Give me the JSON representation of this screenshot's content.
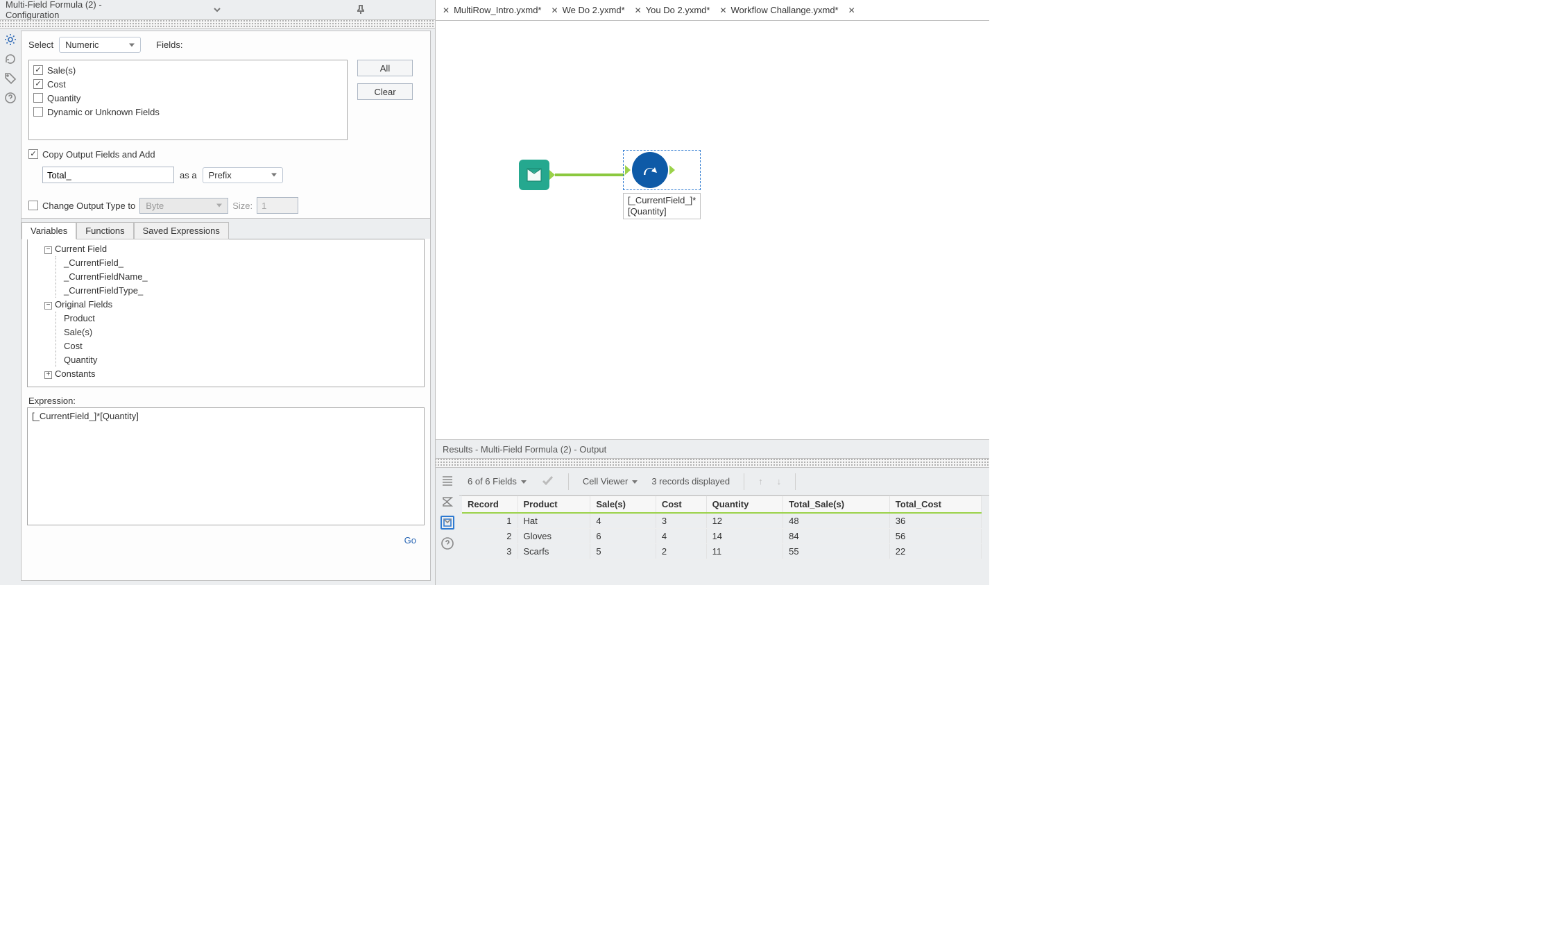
{
  "config": {
    "title": "Multi-Field Formula (2) - Configuration",
    "select_label": "Select",
    "select_value": "Numeric",
    "fields_label": "Fields:",
    "all_btn": "All",
    "clear_btn": "Clear",
    "field_items": [
      {
        "label": "Sale(s)",
        "checked": true
      },
      {
        "label": "Cost",
        "checked": true
      },
      {
        "label": "Quantity",
        "checked": false
      },
      {
        "label": "Dynamic or Unknown Fields",
        "checked": false
      }
    ],
    "copy_output_label": "Copy Output Fields and Add",
    "prefix_value": "Total_",
    "as_a_label": "as a",
    "prefix_suffix": "Prefix",
    "change_output_label": "Change Output Type to",
    "byte_label": "Byte",
    "size_label": "Size:",
    "size_value": "1",
    "tabs": {
      "variables": "Variables",
      "functions": "Functions",
      "saved": "Saved Expressions"
    },
    "tree": {
      "current_field": "Current Field",
      "cf1": "_CurrentField_",
      "cf2": "_CurrentFieldName_",
      "cf3": "_CurrentFieldType_",
      "orig": "Original Fields",
      "of1": "Product",
      "of2": "Sale(s)",
      "of3": "Cost",
      "of4": "Quantity",
      "constants": "Constants"
    },
    "expression_label": "Expression:",
    "expression": "[_CurrentField_]*[Quantity]",
    "go": "Go"
  },
  "tabs": [
    {
      "name": "MultiRow_Intro.yxmd*"
    },
    {
      "name": "We Do 2.yxmd*"
    },
    {
      "name": "You Do 2.yxmd*"
    },
    {
      "name": "Workflow Challange.yxmd*"
    }
  ],
  "canvas": {
    "node_label_l1": "[_CurrentField_]*",
    "node_label_l2": "[Quantity]"
  },
  "results": {
    "title": "Results - Multi-Field Formula (2) - Output",
    "fields_info": "6 of 6 Fields",
    "cell_viewer": "Cell Viewer",
    "records_disp": "3 records displayed",
    "headers": [
      "Record",
      "Product",
      "Sale(s)",
      "Cost",
      "Quantity",
      "Total_Sale(s)",
      "Total_Cost"
    ],
    "rows": [
      [
        "1",
        "Hat",
        "4",
        "3",
        "12",
        "48",
        "36"
      ],
      [
        "2",
        "Gloves",
        "6",
        "4",
        "14",
        "84",
        "56"
      ],
      [
        "3",
        "Scarfs",
        "5",
        "2",
        "11",
        "55",
        "22"
      ]
    ]
  }
}
